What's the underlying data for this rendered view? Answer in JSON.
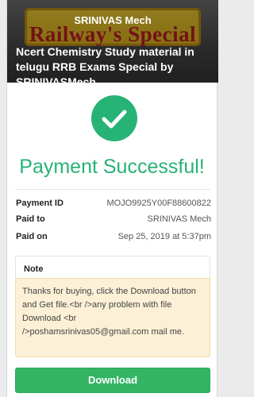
{
  "banner": {
    "image_text": "Railway's Special",
    "author": "SRINIVAS Mech",
    "title": "Ncert Chemistry Study material in telugu RRB Exams Special by SRINIVASMech"
  },
  "status": {
    "title": "Payment Successful!",
    "icon": "check-icon",
    "color": "#27b276"
  },
  "details": [
    {
      "label": "Payment ID",
      "value": "MOJO9925Y00F88600822"
    },
    {
      "label": "Paid to",
      "value": "SRINIVAS Mech"
    },
    {
      "label": "Paid on",
      "value": "Sep 25, 2019 at 5:37pm"
    }
  ],
  "note": {
    "heading": "Note",
    "body": "Thanks for buying, click the Download button and Get file.<br />any problem with file Download <br />poshamsrinivas05@gmail.com mail me."
  },
  "actions": {
    "download_label": "Download",
    "download_color": "#33b464"
  }
}
